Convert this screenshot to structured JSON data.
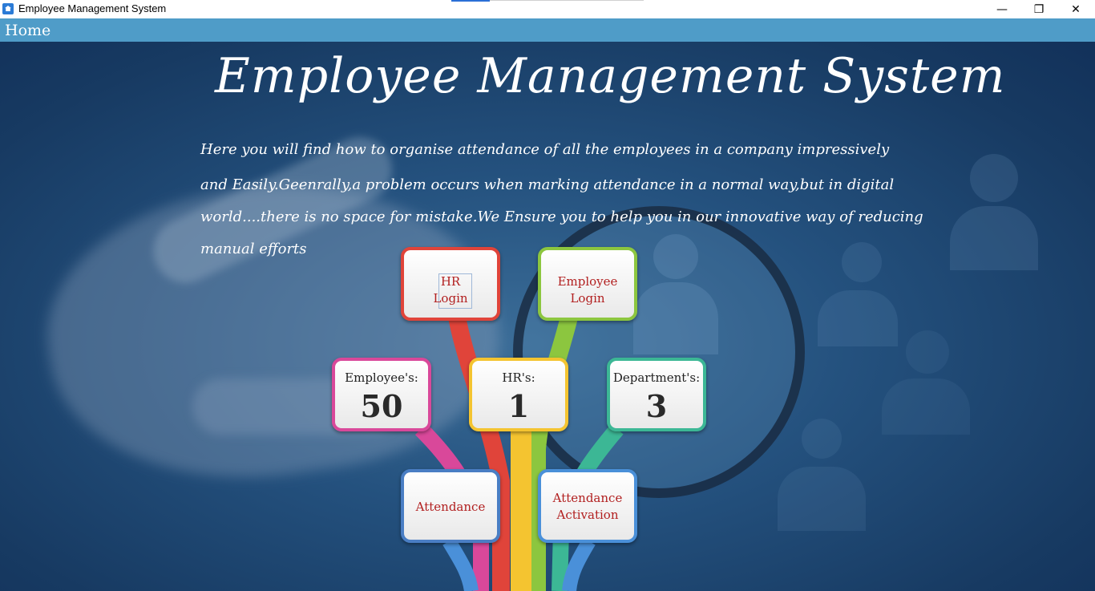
{
  "window": {
    "title": "Employee Management System",
    "controls": {
      "minimize": "—",
      "maximize": "❐",
      "close": "✕"
    }
  },
  "menu": {
    "home": "Home"
  },
  "hero": {
    "title": "Employee Management System",
    "lines": [
      "Here you will find how to organise attendance of all the employees in a company impressively",
      "and Easily.Geenrally,a problem occurs when  marking attendance in a normal way,but in digital",
      "world....there is no space for mistake.We Ensure you to help you in our innovative way of reducing",
      " manual efforts"
    ]
  },
  "buttons": {
    "hr_login": [
      "HR",
      "Login"
    ],
    "employee_login": [
      "Employee",
      "Login"
    ],
    "attendance": "Attendance",
    "attendance_activation": [
      "Attendance",
      "Activation"
    ]
  },
  "stats": {
    "employees": {
      "label": "Employee's:",
      "value": "50"
    },
    "hrs": {
      "label": "HR's:",
      "value": "1"
    },
    "departments": {
      "label": "Department's:",
      "value": "3"
    }
  },
  "colors": {
    "menubar": "#4f9cc8",
    "red": "#e0443a",
    "green": "#8cc63f",
    "pink": "#d9489a",
    "yellow": "#f4c430",
    "teal": "#3cb795",
    "blue": "#4a90d9",
    "button_text": "#b22020"
  }
}
